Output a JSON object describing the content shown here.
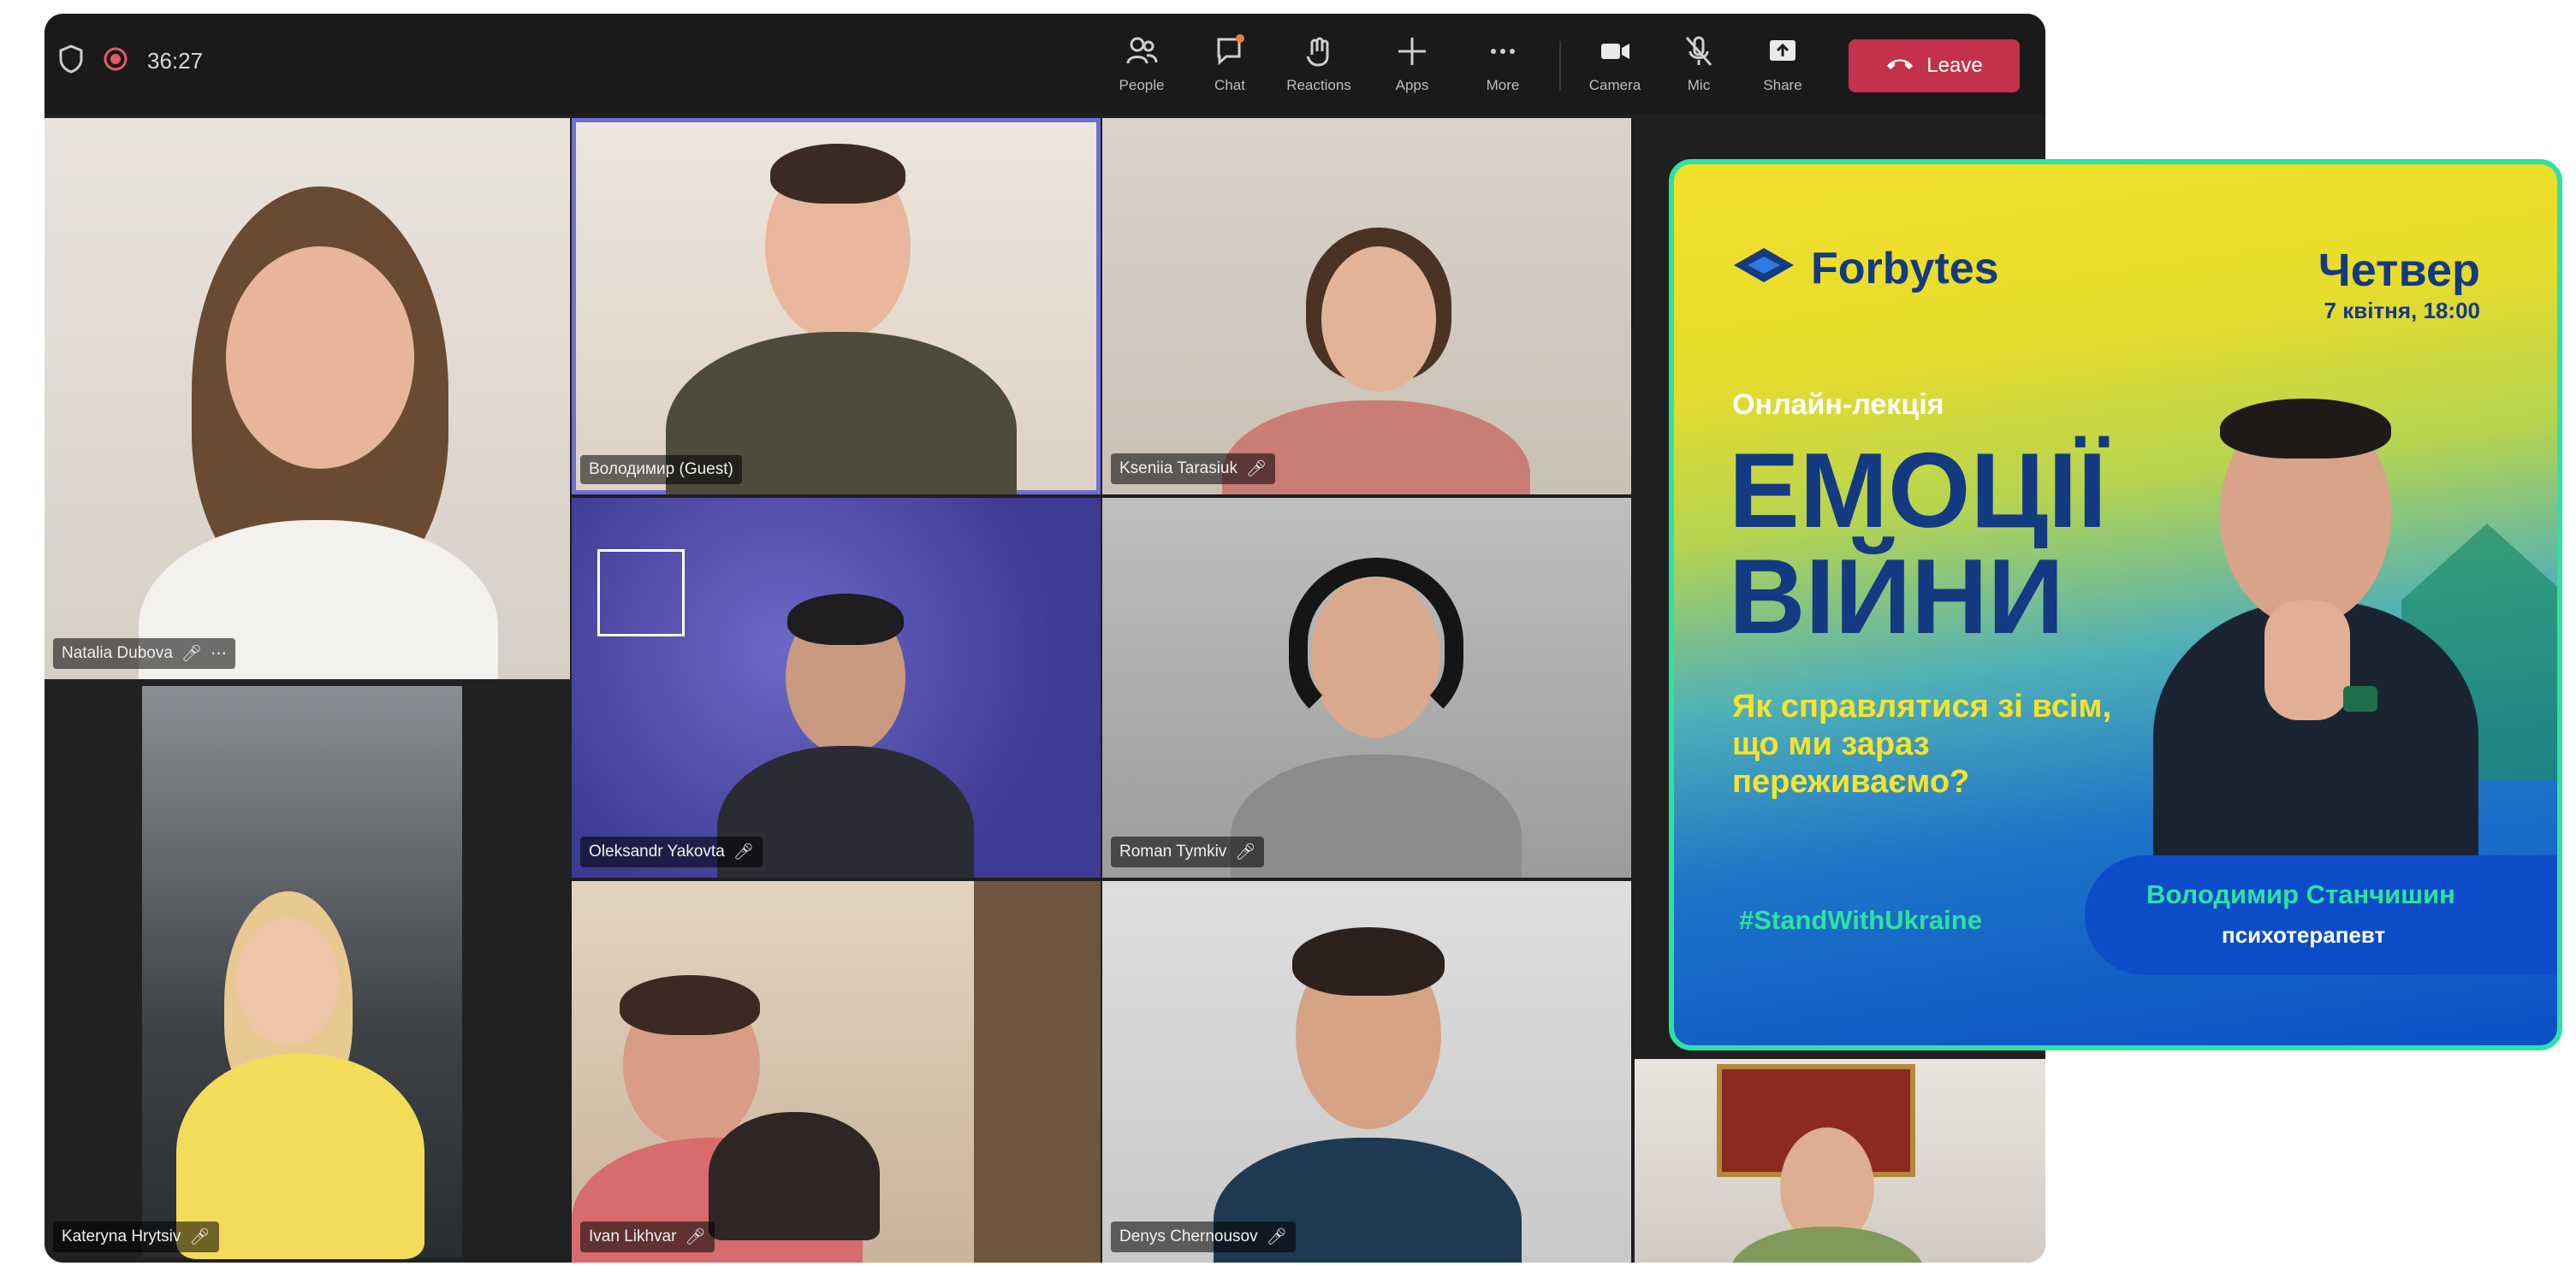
{
  "meeting": {
    "timer": "36:27",
    "toolbar": [
      {
        "key": "people",
        "label": "People",
        "icon": "people-icon"
      },
      {
        "key": "chat",
        "label": "Chat",
        "icon": "chat-icon"
      },
      {
        "key": "reactions",
        "label": "Reactions",
        "icon": "reactions-icon"
      },
      {
        "key": "apps",
        "label": "Apps",
        "icon": "plus-icon"
      },
      {
        "key": "more",
        "label": "More",
        "icon": "more-icon"
      },
      {
        "key": "camera",
        "label": "Camera",
        "icon": "camera-icon"
      },
      {
        "key": "mic",
        "label": "Mic",
        "icon": "mic-off-icon"
      },
      {
        "key": "share",
        "label": "Share",
        "icon": "share-icon"
      }
    ],
    "leave_label": "Leave"
  },
  "participants": [
    {
      "name": "Natalia Dubova"
    },
    {
      "name": "Володимир (Guest)"
    },
    {
      "name": "Kseniia Tarasiuk"
    },
    {
      "name": "Oleksandr Yakovta"
    },
    {
      "name": "Roman Tymkiv"
    },
    {
      "name": "Kateryna Hrytsiv"
    },
    {
      "name": "Ivan Likhvar"
    },
    {
      "name": "Denys Chernousov"
    },
    {
      "name": ""
    }
  ],
  "poster": {
    "brand": "Forbytes",
    "day": "Четвер",
    "date": "7 квітня, 18:00",
    "lecture_type": "Онлайн-лекція",
    "title_line1": "ЕМОЦІЇ",
    "title_line2": "ВІЙНИ",
    "question": "Як справлятися зі всім, що ми зараз переживаємо?",
    "hashtag": "#StandWithUkraine",
    "speaker_name": "Володимир Станчишин",
    "speaker_role": "психотерапевт",
    "colors": {
      "brand_blue": "#143a82",
      "accent_green": "#2ee2a0",
      "accent_yellow": "#f6e42a"
    }
  }
}
